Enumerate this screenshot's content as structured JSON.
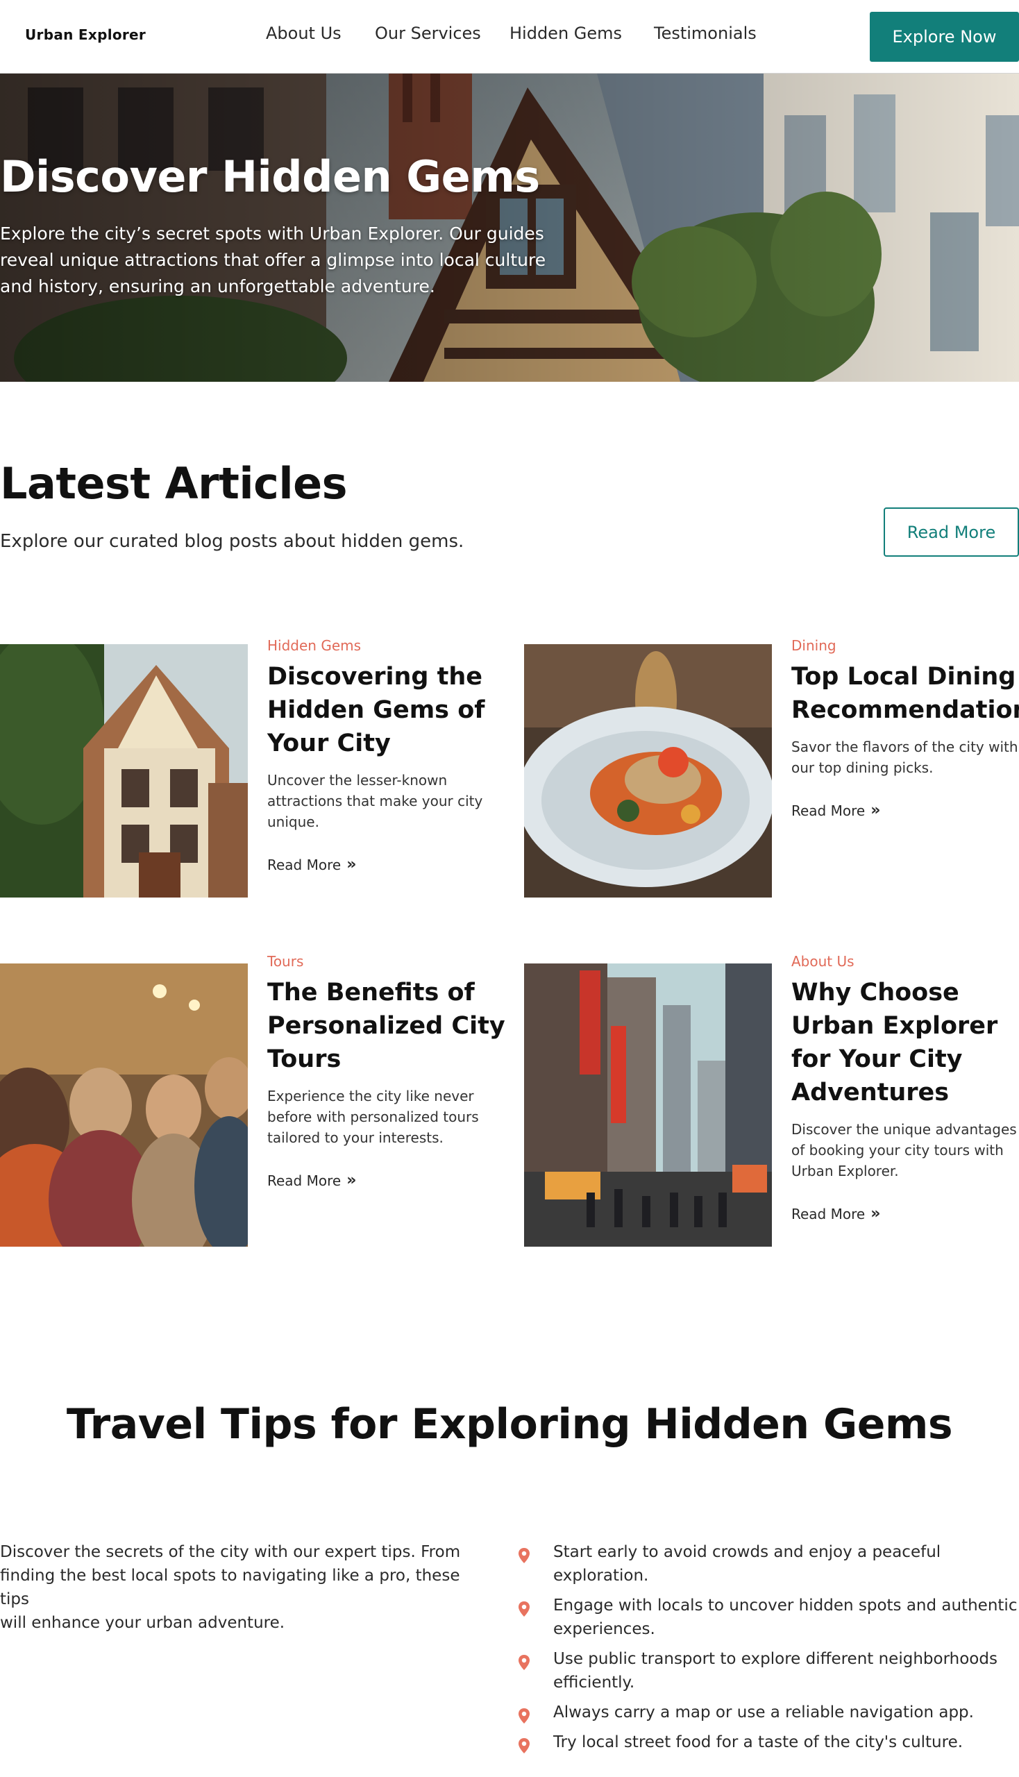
{
  "header": {
    "brand": "Urban Explorer",
    "nav": [
      {
        "label": "About Us"
      },
      {
        "label": "Our Services"
      },
      {
        "label": "Hidden Gems"
      },
      {
        "label": "Testimonials"
      }
    ],
    "cta_label": "Explore Now"
  },
  "hero": {
    "title": "Discover Hidden Gems",
    "text": "Explore the city’s secret spots with Urban Explorer. Our guides reveal unique attractions that offer a glimpse into local culture and history, ensuring an unforgettable adventure."
  },
  "articles": {
    "title": "Latest Articles",
    "subtitle": "Explore our curated blog posts about hidden gems.",
    "read_more_button": "Read More",
    "items": [
      {
        "category": "Hidden Gems",
        "title": "Discovering the\nHidden Gems of\nYour City",
        "description": "Uncover the lesser-known\nattractions that make your city\nunique.",
        "link": "Read More"
      },
      {
        "category": "Dining",
        "title": "Top Local Dining\nRecommendations",
        "description": "Savor the flavors of the city with\nour top dining picks.",
        "link": "Read More"
      },
      {
        "category": "Tours",
        "title": "The Benefits of\nPersonalized City\nTours",
        "description": "Experience the city like never\nbefore with personalized tours\ntailored to your interests.",
        "link": "Read More"
      },
      {
        "category": "About Us",
        "title": "Why Choose\nUrban Explorer\nfor Your City\nAdventures",
        "description": "Discover the unique advantages\nof booking your city tours with\nUrban Explorer.",
        "link": "Read More"
      }
    ]
  },
  "tips": {
    "title": "Travel Tips for Exploring Hidden Gems",
    "intro": "Discover the secrets of the city with our expert tips. From\nfinding the best local spots to navigating like a pro, these tips\nwill enhance your urban adventure.",
    "items": [
      "Start early to avoid crowds and enjoy a peaceful\nexploration.",
      "Engage with locals to uncover hidden spots and authentic\nexperiences.",
      "Use public transport to explore different neighborhoods\nefficiently.",
      "Always carry a map or use a reliable navigation app.",
      "Try local street food for a taste of the city's culture."
    ],
    "icon": "map-pin-icon"
  },
  "colors": {
    "accent": "#127f7a",
    "category": "#e16a58",
    "pin": "#e8735f"
  }
}
